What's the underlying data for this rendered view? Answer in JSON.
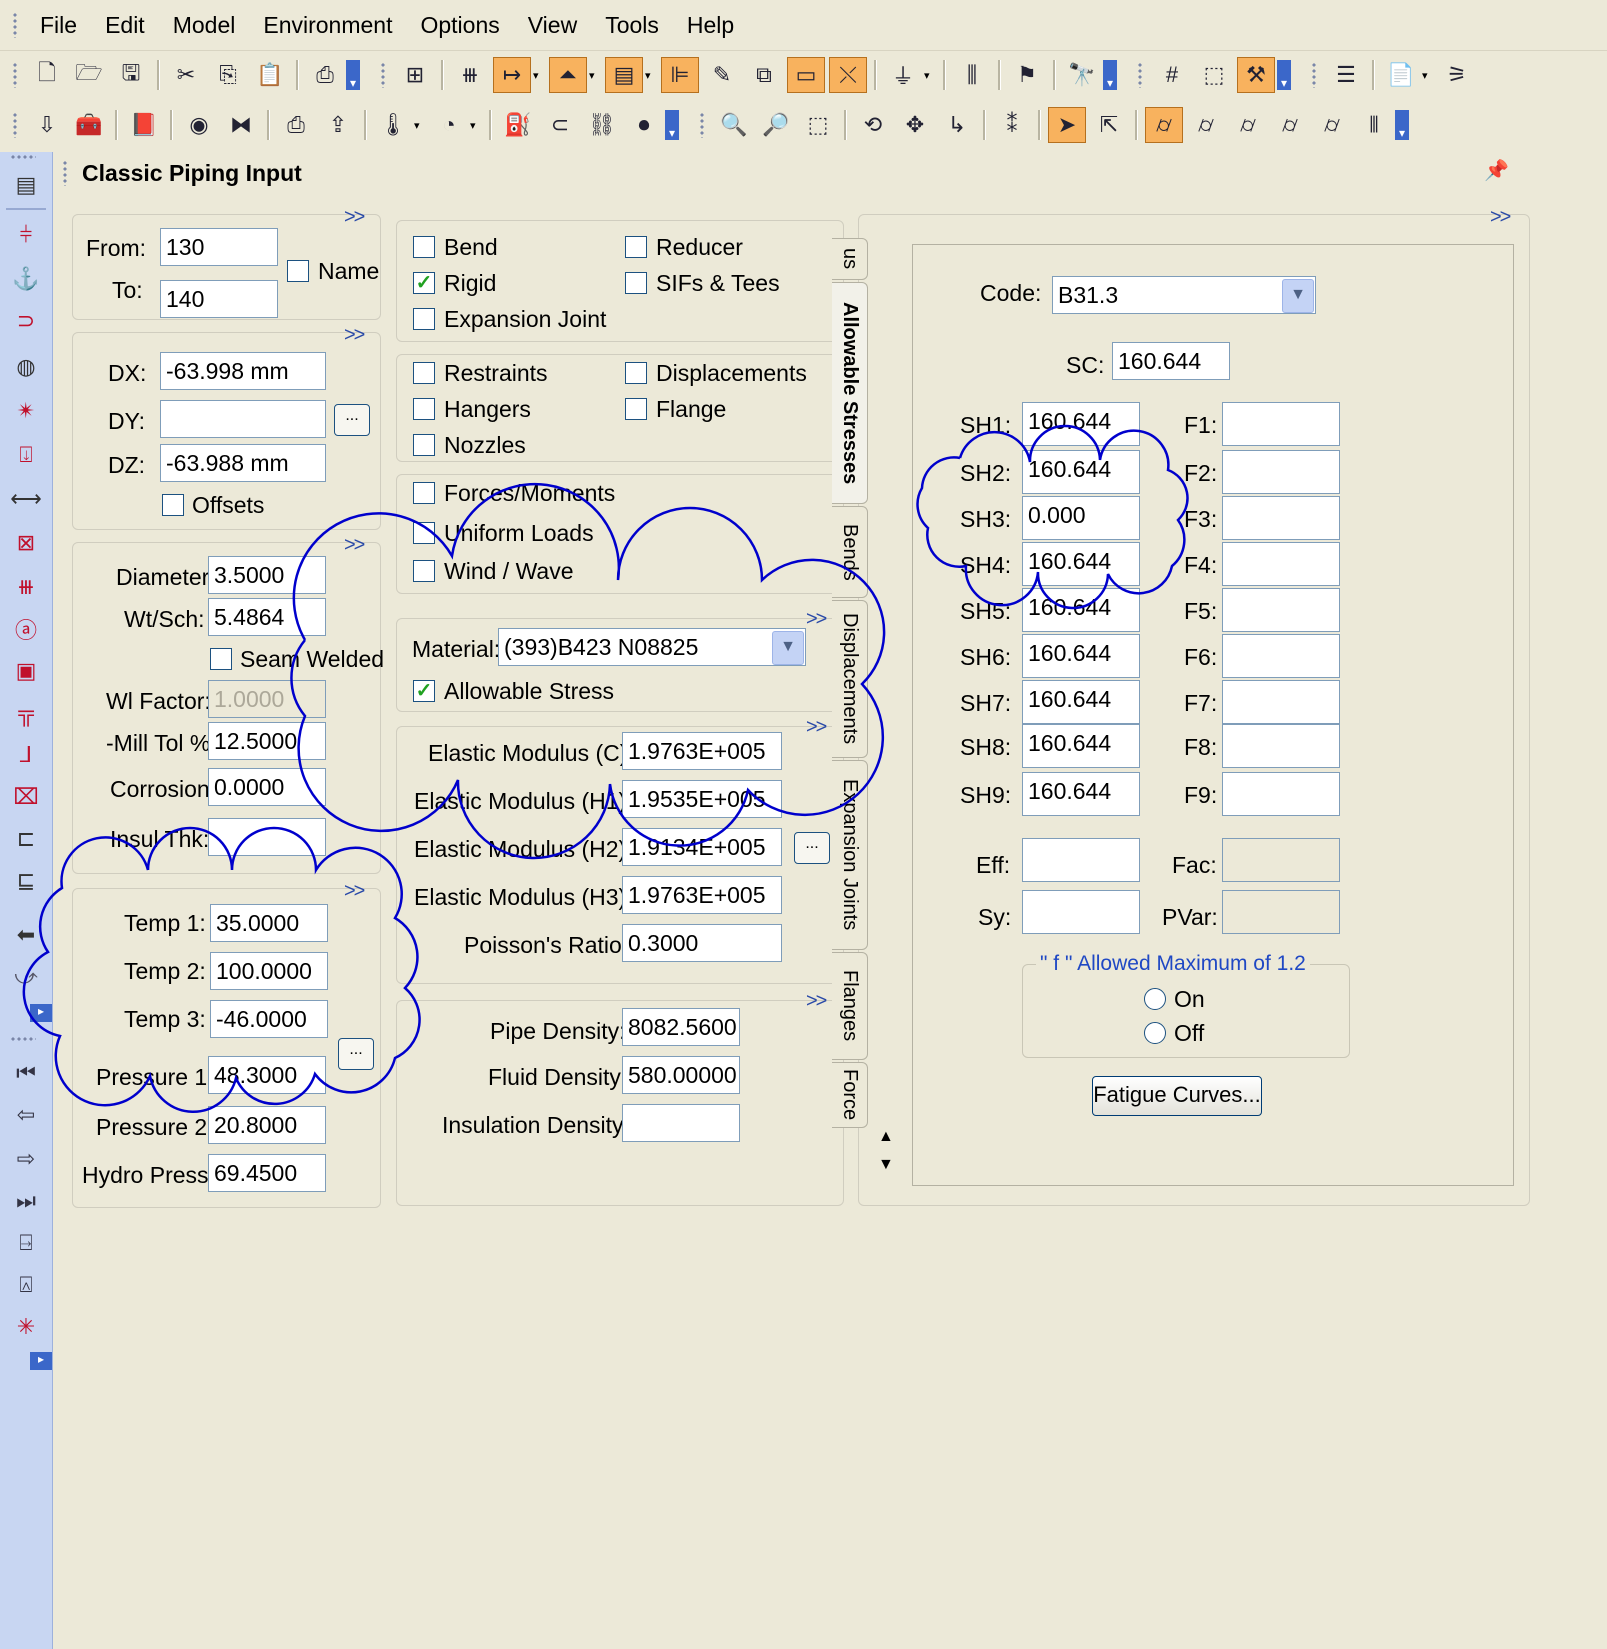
{
  "menu": [
    "File",
    "Edit",
    "Model",
    "Environment",
    "Options",
    "View",
    "Tools",
    "Help"
  ],
  "panel": {
    "title": "Classic Piping Input"
  },
  "node": {
    "from_label": "From:",
    "from": "130",
    "to_label": "To:",
    "to": "140",
    "name_label": "Name"
  },
  "delta": {
    "dx_label": "DX:",
    "dx": "-63.998 mm",
    "dy_label": "DY:",
    "dy": "",
    "dz_label": "DZ:",
    "dz": "-63.988 mm",
    "offsets_label": "Offsets"
  },
  "pipe": {
    "diameter_label": "Diameter:",
    "diameter": "3.5000",
    "wtsch_label": "Wt/Sch:",
    "wtsch": "5.4864",
    "seam_label": "Seam Welded",
    "wl_label": "Wl Factor:",
    "wl": "1.0000",
    "mill_label": "-Mill Tol %:",
    "mill": "12.5000",
    "corrosion_label": "Corrosion:",
    "corrosion": "0.0000",
    "insul_label": "Insul Thk:",
    "insul": ""
  },
  "temps": {
    "t1_label": "Temp 1:",
    "t1": "35.0000",
    "t2_label": "Temp 2:",
    "t2": "100.0000",
    "t3_label": "Temp 3:",
    "t3": "-46.0000",
    "p1_label": "Pressure 1:",
    "p1": "48.3000",
    "p2_label": "Pressure 2:",
    "p2": "20.8000",
    "hydro_label": "Hydro Press:",
    "hydro": "69.4500"
  },
  "elements": {
    "bend": "Bend",
    "reducer": "Reducer",
    "rigid": "Rigid",
    "sifs": "SIFs & Tees",
    "expansion": "Expansion Joint",
    "rigid_checked": true
  },
  "boundary": {
    "restraints": "Restraints",
    "displacements": "Displacements",
    "hangers": "Hangers",
    "flange": "Flange",
    "nozzles": "Nozzles"
  },
  "loads": {
    "forces": "Forces/Moments",
    "uniform": "Uniform Loads",
    "wind": "Wind / Wave"
  },
  "material": {
    "label": "Material:",
    "value": "(393)B423 N08825",
    "allowable_label": "Allowable Stress",
    "allowable_checked": true
  },
  "elastic": {
    "ec_label": "Elastic Modulus (C):",
    "ec": "1.9763E+005",
    "eh1_label": "Elastic Modulus (H1):",
    "eh1": "1.9535E+005",
    "eh2_label": "Elastic Modulus (H2):",
    "eh2": "1.9134E+005",
    "eh3_label": "Elastic Modulus (H3):",
    "eh3": "1.9763E+005",
    "poisson_label": "Poisson's Ratio:",
    "poisson": "0.3000"
  },
  "density": {
    "pipe_label": "Pipe Density:",
    "pipe": "8082.5600",
    "fluid_label": "Fluid Density:",
    "fluid": "580.00000",
    "insul_label": "Insulation Density:",
    "insul": ""
  },
  "tabs": [
    "us",
    "Allowable Stresses",
    "Bends",
    "Displacements",
    "Expansion Joints",
    "Flanges",
    "Force"
  ],
  "allowable": {
    "code_label": "Code:",
    "code": "B31.3",
    "sc_label": "SC:",
    "sc": "160.644",
    "sh": [
      {
        "label": "SH1:",
        "value": "160.644",
        "f_label": "F1:",
        "f": ""
      },
      {
        "label": "SH2:",
        "value": "160.644",
        "f_label": "F2:",
        "f": ""
      },
      {
        "label": "SH3:",
        "value": "0.000",
        "f_label": "F3:",
        "f": ""
      },
      {
        "label": "SH4:",
        "value": "160.644",
        "f_label": "F4:",
        "f": ""
      },
      {
        "label": "SH5:",
        "value": "160.644",
        "f_label": "F5:",
        "f": ""
      },
      {
        "label": "SH6:",
        "value": "160.644",
        "f_label": "F6:",
        "f": ""
      },
      {
        "label": "SH7:",
        "value": "160.644",
        "f_label": "F7:",
        "f": ""
      },
      {
        "label": "SH8:",
        "value": "160.644",
        "f_label": "F8:",
        "f": ""
      },
      {
        "label": "SH9:",
        "value": "160.644",
        "f_label": "F9:",
        "f": ""
      }
    ],
    "eff_label": "Eff:",
    "eff": "",
    "fac_label": "Fac:",
    "fac": "",
    "sy_label": "Sy:",
    "sy": "",
    "pvar_label": "PVar:",
    "pvar": "",
    "fmax_legend": "\" f \" Allowed Maximum of 1.2",
    "on_label": "On",
    "off_label": "Off",
    "fatigue_button": "Fatigue Curves..."
  },
  "colors": {
    "accent": "#F8B25E",
    "annotation": "#0000CC",
    "panel_bg": "#ECE9D8",
    "sidebar": "#C8D6F2"
  }
}
